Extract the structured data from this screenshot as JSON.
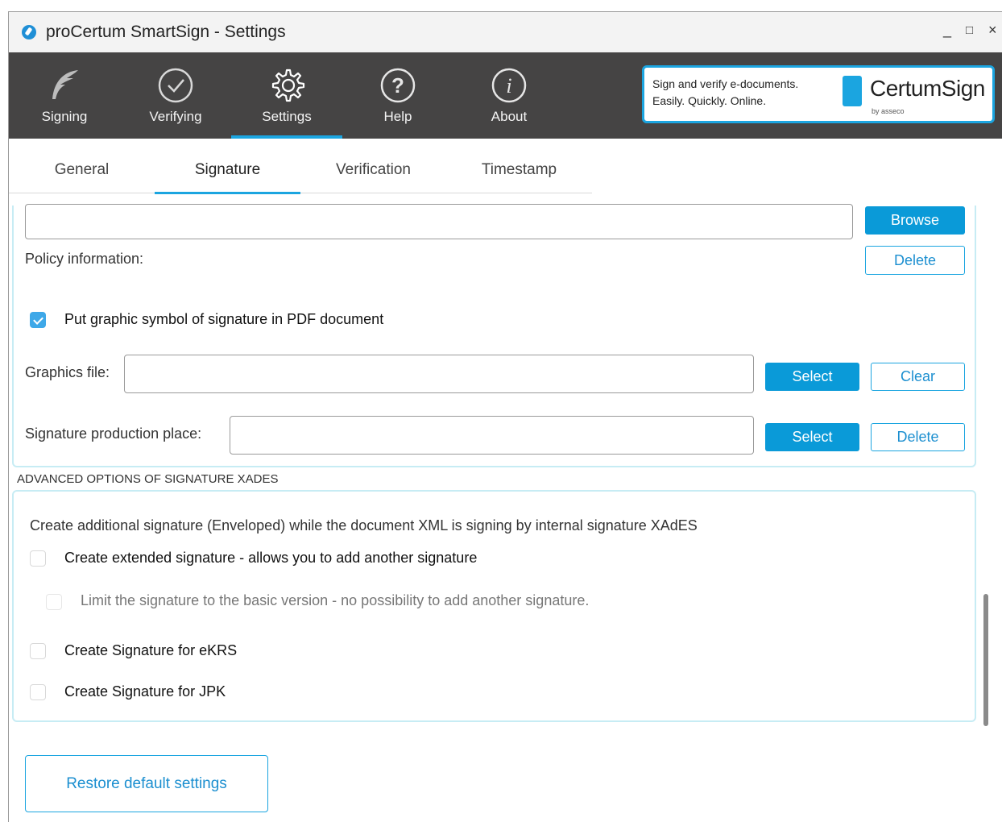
{
  "window": {
    "title": "proCertum SmartSign - Settings",
    "controls": {
      "minimize": "_",
      "maximize": "□",
      "close": "×"
    }
  },
  "toolbar": {
    "items": [
      {
        "label": "Signing",
        "icon": "feather-icon"
      },
      {
        "label": "Verifying",
        "icon": "check-circle-icon"
      },
      {
        "label": "Settings",
        "icon": "gear-icon",
        "active": true
      },
      {
        "label": "Help",
        "icon": "question-circle-icon"
      },
      {
        "label": "About",
        "icon": "info-circle-icon"
      }
    ],
    "banner": {
      "line1": "Sign and verify e-documents.",
      "line2": "Easily. Quickly. Online.",
      "brand": "CertumSign",
      "by": "by asseco"
    }
  },
  "tabs": [
    {
      "label": "General"
    },
    {
      "label": "Signature",
      "active": true
    },
    {
      "label": "Verification"
    },
    {
      "label": "Timestamp"
    }
  ],
  "signature": {
    "policy_field_value": "",
    "browse_label": "Browse",
    "policy_info_label": "Policy information:",
    "delete_label": "Delete",
    "graphic_symbol_label": "Put graphic symbol of signature in PDF document",
    "graphic_symbol_checked": true,
    "graphics_file_label": "Graphics file:",
    "graphics_file_value": "",
    "graphics_select_label": "Select",
    "graphics_clear_label": "Clear",
    "production_place_label": "Signature production place:",
    "production_place_value": "",
    "production_select_label": "Select",
    "production_delete_label": "Delete"
  },
  "advanced": {
    "header": "ADVANCED OPTIONS OF SIGNATURE XADES",
    "description": "Create additional signature (Enveloped) while the document XML is signing by internal signature XAdES",
    "options": [
      {
        "label": "Create extended signature - allows you to add another signature",
        "checked": false
      },
      {
        "label": "Limit the signature to the basic version - no possibility to add another signature.",
        "checked": false,
        "disabled": true
      },
      {
        "label": "Create Signature for eKRS",
        "checked": false
      },
      {
        "label": "Create Signature for JPK",
        "checked": false
      }
    ]
  },
  "footer": {
    "restore_label": "Restore default settings"
  },
  "colors": {
    "accent": "#1ba5e0",
    "toolbar_bg": "#454444",
    "button_primary": "#0a9ad8"
  }
}
